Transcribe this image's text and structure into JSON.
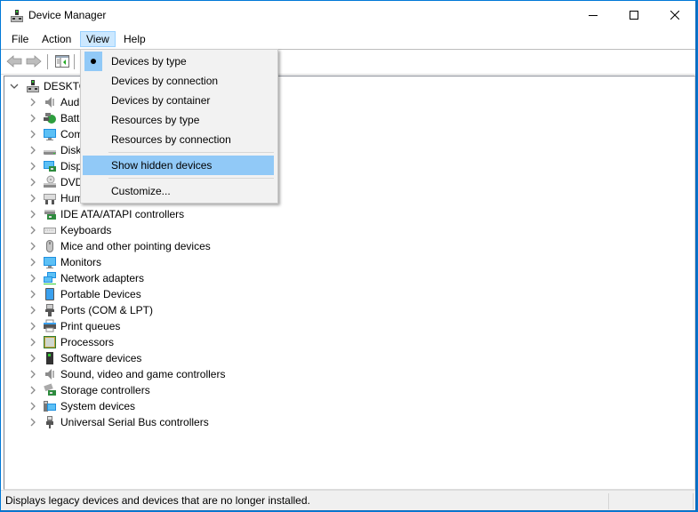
{
  "window": {
    "title": "Device Manager",
    "controls": {
      "minimize": "minimize-icon",
      "maximize": "maximize-icon",
      "close": "close-icon"
    }
  },
  "menubar": {
    "items": [
      {
        "label": "File"
      },
      {
        "label": "Action"
      },
      {
        "label": "View",
        "active": true
      },
      {
        "label": "Help"
      }
    ]
  },
  "toolbar": {
    "buttons": [
      {
        "icon": "back-arrow-icon",
        "enabled": false
      },
      {
        "icon": "forward-arrow-icon",
        "enabled": false
      },
      {
        "icon": "show-hide-console-tree-icon",
        "enabled": true
      }
    ]
  },
  "view_menu": {
    "items": [
      {
        "label": "Devices by type",
        "checked": true
      },
      {
        "label": "Devices by connection"
      },
      {
        "label": "Devices by container"
      },
      {
        "label": "Resources by type"
      },
      {
        "label": "Resources by connection"
      },
      {
        "label": "Show hidden devices",
        "highlighted": true
      },
      {
        "label": "Customize..."
      }
    ]
  },
  "tree": {
    "root": {
      "label": "DESKTOP",
      "icon": "computer-icon",
      "expanded": true
    },
    "categories": [
      {
        "label": "Audio inputs and outputs",
        "icon": "speaker-icon"
      },
      {
        "label": "Batteries",
        "icon": "battery-icon"
      },
      {
        "label": "Computer",
        "icon": "monitor-icon"
      },
      {
        "label": "Disk drives",
        "icon": "disk-drive-icon"
      },
      {
        "label": "Display adapters",
        "icon": "display-adapter-icon"
      },
      {
        "label": "DVD/CD-ROM drives",
        "icon": "dvd-drive-icon"
      },
      {
        "label": "Human Interface Devices",
        "icon": "hid-icon"
      },
      {
        "label": "IDE ATA/ATAPI controllers",
        "icon": "ide-controller-icon"
      },
      {
        "label": "Keyboards",
        "icon": "keyboard-icon"
      },
      {
        "label": "Mice and other pointing devices",
        "icon": "mouse-icon"
      },
      {
        "label": "Monitors",
        "icon": "monitor-icon"
      },
      {
        "label": "Network adapters",
        "icon": "network-adapter-icon"
      },
      {
        "label": "Portable Devices",
        "icon": "portable-device-icon"
      },
      {
        "label": "Ports (COM & LPT)",
        "icon": "port-icon"
      },
      {
        "label": "Print queues",
        "icon": "printer-icon"
      },
      {
        "label": "Processors",
        "icon": "processor-icon"
      },
      {
        "label": "Software devices",
        "icon": "software-device-icon"
      },
      {
        "label": "Sound, video and game controllers",
        "icon": "speaker-icon"
      },
      {
        "label": "Storage controllers",
        "icon": "storage-controller-icon"
      },
      {
        "label": "System devices",
        "icon": "system-device-icon"
      },
      {
        "label": "Universal Serial Bus controllers",
        "icon": "usb-icon"
      }
    ]
  },
  "statusbar": {
    "text": "Displays legacy devices and devices that are no longer installed."
  }
}
